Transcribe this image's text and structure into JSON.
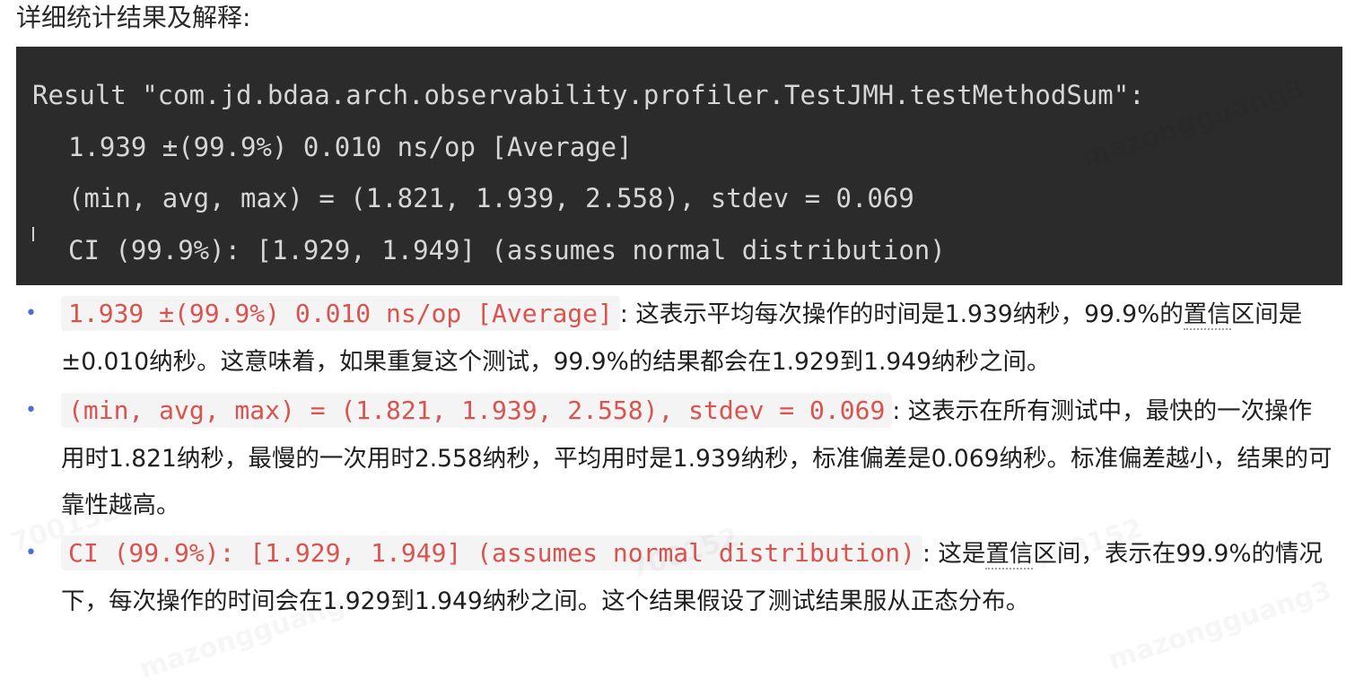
{
  "heading": "详细统计结果及解释:",
  "code_block": {
    "lines": [
      "Result \"com.jd.bdaa.arch.observability.profiler.TestJMH.testMethodSum\":",
      "1.939 ±(99.9%) 0.010 ns/op [Average]",
      "(min, avg, max) = (1.821, 1.939, 2.558), stdev = 0.069",
      "CI (99.9%): [1.929, 1.949] (assumes normal distribution)"
    ]
  },
  "bullets": [
    {
      "code": "1.939 ±(99.9%) 0.010 ns/op [Average]",
      "text_a": ": 这表示平均每次操作的时间是1.939纳秒，99.9%的",
      "underlined": "置信",
      "text_b": "区间是±0.010纳秒。这意味着，如果重复这个测试，99.9%的结果都会在1.929到1.949纳秒之间。"
    },
    {
      "code": "(min, avg, max) = (1.821, 1.939, 2.558), stdev = 0.069",
      "text_a": ": 这表示在所有测试中，最快的一次操作用时1.821纳秒，最慢的一次用时2.558纳秒，平均用时是1.939纳秒，标准偏差是0.069纳秒。标准偏差越小，结果的可靠性越高。"
    },
    {
      "code": "CI (99.9%): [1.929, 1.949] (assumes normal distribution)",
      "text_a": ": 这是",
      "underlined": "置信",
      "text_b": "区间，表示在99.9%的情况下，每次操作的时间会在1.929到1.949纳秒之间。这个结果假设了测试结果服从正态分布。"
    }
  ],
  "watermark": {
    "texts": [
      "mazongguang3",
      "700152",
      "mazongguang3",
      "700152",
      "mazongguang3",
      "700152"
    ]
  },
  "colors": {
    "code_bg": "#2b2b2b",
    "code_text": "#d6d6d6",
    "inline_code_text": "#d9534f",
    "bullet": "#4a6fd6"
  }
}
